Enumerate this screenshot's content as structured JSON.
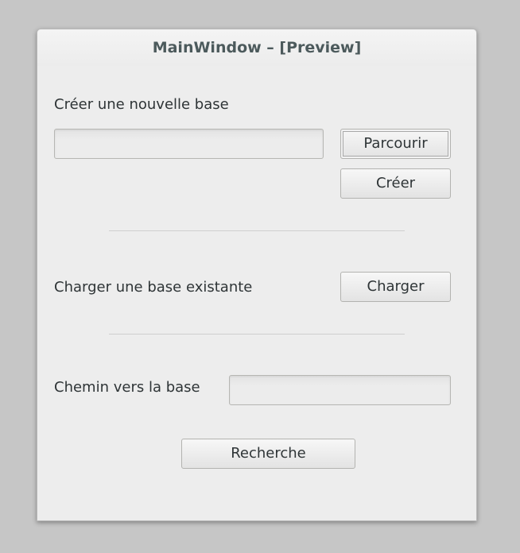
{
  "window": {
    "title": "MainWindow – [Preview]"
  },
  "create_section": {
    "label": "Créer une nouvelle base",
    "path_value": "",
    "browse_label": "Parcourir",
    "create_label": "Créer"
  },
  "load_section": {
    "label": "Charger une base existante",
    "load_label": "Charger"
  },
  "path_section": {
    "label": "Chemin vers la base",
    "path_value": ""
  },
  "search": {
    "label": "Recherche"
  }
}
